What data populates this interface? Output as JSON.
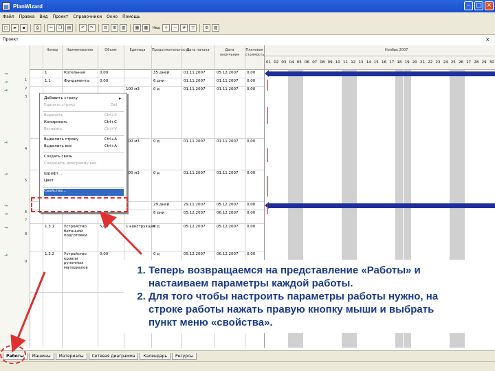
{
  "window": {
    "title": "PlanWizard"
  },
  "menu": [
    "Файл",
    "Правка",
    "Вид",
    "Проект",
    "Справочники",
    "Окно",
    "Помощь"
  ],
  "toolbar": {
    "zoom_label": "Нед",
    "icons": [
      "new-icon",
      "open-icon",
      "save-icon",
      "print-icon",
      "cut-icon",
      "copy-icon",
      "paste-icon",
      "undo-icon",
      "redo-icon",
      "link-icon",
      "unlink-icon",
      "gantt-icon",
      "table-icon",
      "calendar-icon"
    ]
  },
  "project_label": "Проект",
  "table": {
    "headers": [
      "Номер",
      "Наименование",
      "Объем",
      "Единица",
      "Продолжительность",
      "Дата начала",
      "Дата окончания",
      "Плановая стоимость"
    ],
    "rows": [
      {
        "num": "1",
        "name": "Котельная",
        "vol": "0,00",
        "unit": "",
        "dur": "35 дней",
        "start": "01.11.2007",
        "end": "05.12.2007",
        "cost": "0,00"
      },
      {
        "num": "1.1",
        "name": "Фундаменты",
        "vol": "0,00",
        "unit": "",
        "dur": "6 дни",
        "start": "01.11.2007",
        "end": "01.11.2007",
        "cost": "0,00"
      },
      {
        "num": "",
        "name": "",
        "vol": "",
        "unit": "100 м3",
        "dur": "0 д",
        "start": "01.11.2007",
        "end": "01.11.2007",
        "cost": "0,00"
      },
      {
        "num": "",
        "name": "",
        "vol": "",
        "unit": "100 м3",
        "dur": "0 д",
        "start": "01.11.2007",
        "end": "01.11.2007",
        "cost": "0,00"
      },
      {
        "num": "",
        "name": "",
        "vol": "",
        "unit": "100 м3",
        "dur": "0 д",
        "start": "01.11.2007",
        "end": "01.11.2007",
        "cost": "0,00"
      },
      {
        "num": "",
        "name": "Кровля",
        "vol": "",
        "unit": "",
        "dur": "29 дней",
        "start": "29.11.2007",
        "end": "05.12.2007",
        "cost": "0,00"
      },
      {
        "num": "",
        "name": "Кровля",
        "vol": "0,00",
        "unit": "",
        "dur": "6 дни",
        "start": "05.12.2007",
        "end": "06.12.2007",
        "cost": "0,00"
      },
      {
        "num": "1.3.1",
        "name": "Устройство бетонной подготовки",
        "vol": "5,00",
        "unit": "1 конструкция",
        "dur": "0 д",
        "start": "05.12.2007",
        "end": "05.12.2007",
        "cost": "0,00"
      },
      {
        "num": "1.3.2",
        "name": "Устройство кровли рулонных материалов",
        "vol": "0,00",
        "unit": "",
        "dur": "0 д",
        "start": "05.12.2007",
        "end": "06.12.2007",
        "cost": "0,00"
      }
    ]
  },
  "gantt": {
    "title": "Ноябрь 2007",
    "days": [
      "01",
      "02",
      "03",
      "04",
      "05",
      "06",
      "07",
      "08",
      "09",
      "10",
      "11",
      "12",
      "13",
      "14",
      "15",
      "16",
      "17",
      "18",
      "19",
      "20",
      "21",
      "22",
      "23",
      "24",
      "25",
      "26",
      "27",
      "28",
      "29",
      "30"
    ],
    "weekends": [
      3,
      4,
      10,
      11,
      17,
      18,
      24,
      25
    ]
  },
  "context_menu": {
    "items": [
      {
        "label": "Добавить строку",
        "shortcut": "",
        "disabled": false,
        "submenu": true
      },
      {
        "label": "Удалить строку",
        "shortcut": "Del",
        "disabled": true
      },
      {
        "sep": true
      },
      {
        "label": "Вырезать",
        "shortcut": "Ctrl+X",
        "disabled": true
      },
      {
        "label": "Копировать",
        "shortcut": "Ctrl+C",
        "disabled": false
      },
      {
        "label": "Вставить",
        "shortcut": "Ctrl+V",
        "disabled": true
      },
      {
        "sep": true
      },
      {
        "label": "Выделить строку",
        "shortcut": "Ctrl+A",
        "disabled": false
      },
      {
        "label": "Выделить все",
        "shortcut": "Ctrl+A",
        "disabled": false
      },
      {
        "sep": true
      },
      {
        "label": "Создать связь",
        "shortcut": "",
        "disabled": false
      },
      {
        "label": "Сохранить диаграмму как",
        "shortcut": "",
        "disabled": true
      },
      {
        "sep": true
      },
      {
        "label": "Шрифт...",
        "shortcut": "",
        "disabled": false
      },
      {
        "label": "Цвет",
        "shortcut": "",
        "disabled": false
      },
      {
        "sep": true
      },
      {
        "label": "Свойства...",
        "shortcut": "",
        "disabled": false,
        "selected": true
      }
    ]
  },
  "instructions": [
    "Теперь возвращаемся на представление «Работы» и настаиваем параметры каждой работы.",
    "Для того чтобы настроить параметры работы нужно, на строке работы нажать правую кнопку мыши и выбрать пункт меню «свойства»."
  ],
  "tabs": [
    "Работы",
    "Машины",
    "Материалы",
    "Сетевая диаграмма",
    "Календарь",
    "Ресурсы"
  ]
}
